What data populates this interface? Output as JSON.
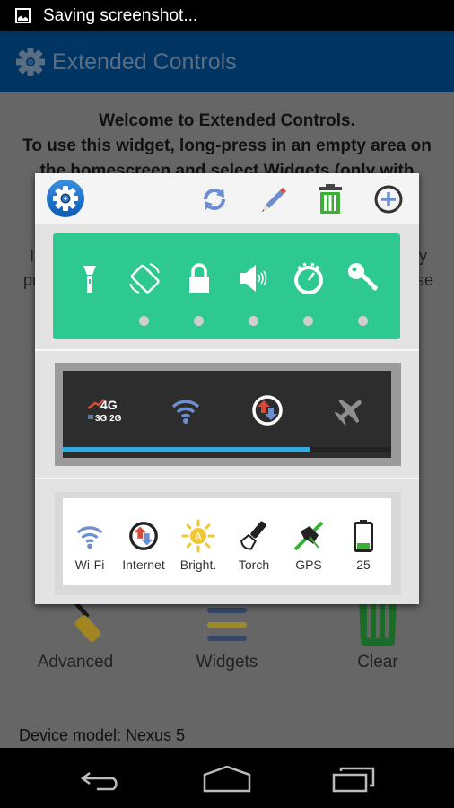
{
  "status_bar": {
    "notification_icon": "image-icon",
    "text": "Saving screenshot..."
  },
  "app_bar": {
    "icon": "gear-icon",
    "title": "Extended Controls"
  },
  "background": {
    "welcome_lines": [
      "Welcome to Extended Controls.",
      "To use this widget, long-press in an empty area on",
      "the homescreen and select Widgets (only with"
    ],
    "obscured_fragments": {
      "left_line1": "I",
      "left_line2": "pr",
      "right_line1": "y",
      "right_line2": "se"
    },
    "tools": [
      {
        "label": "Advanced",
        "icon": "screwdriver-icon"
      },
      {
        "label": "Widgets",
        "icon": "widgets-list-icon"
      },
      {
        "label": "Clear",
        "icon": "trash-icon"
      }
    ],
    "device_model": "Device model: Nexus 5"
  },
  "dialog": {
    "toolbar": {
      "app_icon": "settings-gear-icon",
      "actions": [
        {
          "name": "refresh",
          "icon": "refresh-icon"
        },
        {
          "name": "edit",
          "icon": "pencil-icon"
        },
        {
          "name": "delete",
          "icon": "trash-icon"
        },
        {
          "name": "add",
          "icon": "add-circle-icon"
        }
      ]
    },
    "widget_green": {
      "background": "#2ec991",
      "toggles": [
        {
          "icon": "flashlight-icon",
          "indicator": false
        },
        {
          "icon": "auto-rotate-icon",
          "indicator": true
        },
        {
          "icon": "lock-icon",
          "indicator": true
        },
        {
          "icon": "volume-icon",
          "indicator": true
        },
        {
          "icon": "timeout-icon",
          "indicator": true
        },
        {
          "icon": "key-icon",
          "indicator": true
        }
      ]
    },
    "widget_dark": {
      "background": "#2d2d2d",
      "toggles": [
        {
          "icon": "network-mode-icon",
          "text_top": "4G",
          "text_bottom": "3G 2G"
        },
        {
          "icon": "wifi-icon"
        },
        {
          "icon": "mobile-data-icon"
        },
        {
          "icon": "airplane-icon"
        }
      ],
      "progress_percent": 75,
      "progress_color": "#33a9dd"
    },
    "widget_light": {
      "items": [
        {
          "icon": "wifi-icon",
          "label": "Wi-Fi"
        },
        {
          "icon": "mobile-data-icon",
          "label": "Internet"
        },
        {
          "icon": "auto-brightness-icon",
          "label": "Bright."
        },
        {
          "icon": "torch-icon",
          "label": "Torch"
        },
        {
          "icon": "gps-satellite-icon",
          "label": "GPS"
        },
        {
          "icon": "battery-icon",
          "label": "25"
        }
      ]
    }
  },
  "nav_bar": {
    "buttons": [
      {
        "name": "back",
        "icon": "back-icon"
      },
      {
        "name": "home",
        "icon": "home-icon"
      },
      {
        "name": "recents",
        "icon": "recents-icon"
      }
    ]
  }
}
